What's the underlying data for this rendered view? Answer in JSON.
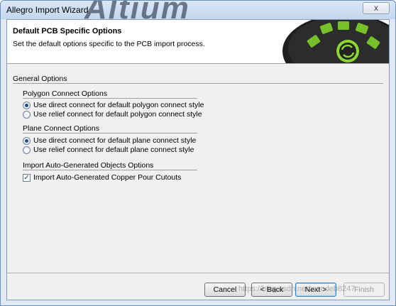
{
  "window": {
    "title": "Allegro Import Wizard",
    "watermark_text": "Altium",
    "close_label": "x"
  },
  "header": {
    "title": "Default PCB Specific Options",
    "subtitle": "Set the default options specific to the PCB import process."
  },
  "general_label": "General Options",
  "groups": [
    {
      "title": "Polygon Connect Options",
      "options": [
        {
          "label": "Use direct connect for default polygon connect style",
          "selected": true
        },
        {
          "label": "Use relief connect for default polygon connect style",
          "selected": false
        }
      ]
    },
    {
      "title": "Plane Connect Options",
      "options": [
        {
          "label": "Use direct connect for default plane connect style",
          "selected": true
        },
        {
          "label": "Use relief connect for default plane connect style",
          "selected": false
        }
      ]
    },
    {
      "title": "Import Auto-Generated Objects Options",
      "options": [
        {
          "label": "Import Auto-Generated Copper Pour Cutouts",
          "checked": true
        }
      ]
    }
  ],
  "buttons": {
    "cancel": "Cancel",
    "back": "< Back",
    "next": "Next >",
    "finish": "Finish"
  },
  "watermark": "https://blog.csdn.net/wondeb8247",
  "colors": {
    "accent": "#8bd832",
    "title_bg": "#c3d7ee"
  }
}
